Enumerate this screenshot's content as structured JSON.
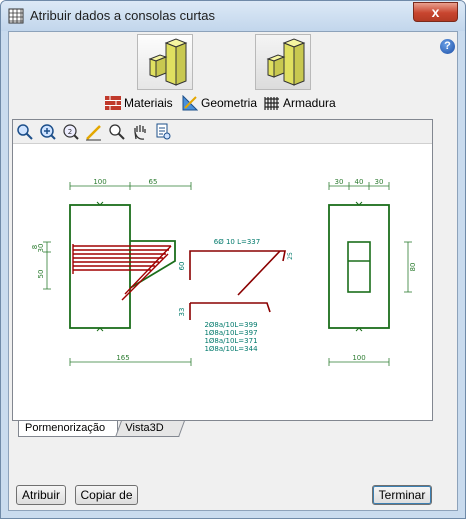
{
  "window": {
    "title": "Atribuir dados a consolas curtas",
    "close_label": "x"
  },
  "help_label": "?",
  "tools": [
    {
      "label": "Materiais",
      "icon": "brick-wall-icon"
    },
    {
      "label": "Geometria",
      "icon": "drafting-icon"
    },
    {
      "label": "Armadura",
      "icon": "rebar-grid-icon"
    }
  ],
  "toolbar_icons": [
    "zoom-window-icon",
    "zoom-extents-icon",
    "zoom-previous-icon",
    "draw-pen-icon",
    "zoom-search-icon",
    "pan-hand-icon",
    "print-preview-icon"
  ],
  "drawing": {
    "front": {
      "dim_top_left": "100",
      "dim_top_right": "65",
      "dim_bottom": "165",
      "dim_left_1": "8",
      "dim_left_2": "30",
      "dim_left_3": "50"
    },
    "bars": {
      "top_label": "6Ø 10 L=337",
      "dim_left": "60",
      "dim_right": "25",
      "dim_bottom_left": "33",
      "list": [
        "2Ø8a/10L=399",
        "1Ø8a/10L=397",
        "1Ø8a/10L=371",
        "1Ø8a/10L=344"
      ]
    },
    "section": {
      "dim_top_1": "30",
      "dim_top_2": "40",
      "dim_top_3": "30",
      "dim_right": "80",
      "dim_bottom": "100"
    }
  },
  "tabs": {
    "active": "Pormenorização",
    "inactive": "Vista3D"
  },
  "buttons": {
    "apply": "Atribuir",
    "copy": "Copiar de",
    "finish": "Terminar"
  }
}
